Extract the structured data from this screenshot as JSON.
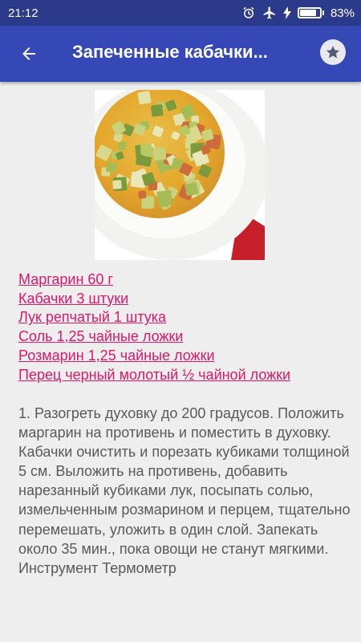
{
  "status_bar": {
    "time": "21:12",
    "battery_percent_label": "83%",
    "battery_level": 0.83,
    "icons": [
      "alarm-icon",
      "airplane-mode-icon",
      "charging-icon",
      "battery-icon"
    ]
  },
  "app_bar": {
    "title": "Запеченные кабачки...",
    "back_icon": "arrow-back-icon",
    "favorite_icon": "star-icon",
    "color": "#3548b5",
    "status_color": "#2b3a8a"
  },
  "recipe": {
    "image_alt": "dish-photo",
    "ingredients": [
      "Маргарин 60 г",
      "Кабачки 3 штуки",
      "Лук репчатый 1 штука",
      "Соль 1,25 чайные ложки",
      "Розмарин 1,25 чайные ложки",
      "Перец черный молотый ½ чайной ложки"
    ],
    "ingredient_color": "#e0166a",
    "instructions": "1. Разогреть духовку до 200 градусов. Положить маргарин на противень и поместить в духовку. Кабачки очистить и порезать кубиками толщиной 5 см. Выложить на противень, добавить нарезанный кубиками лук, посыпать солью, измельченным розмарином и перцем, тщательно перемешать, уложить в один слой. Запекать около 35 мин., пока овощи не станут мягкими. Инструмент Термометр"
  }
}
